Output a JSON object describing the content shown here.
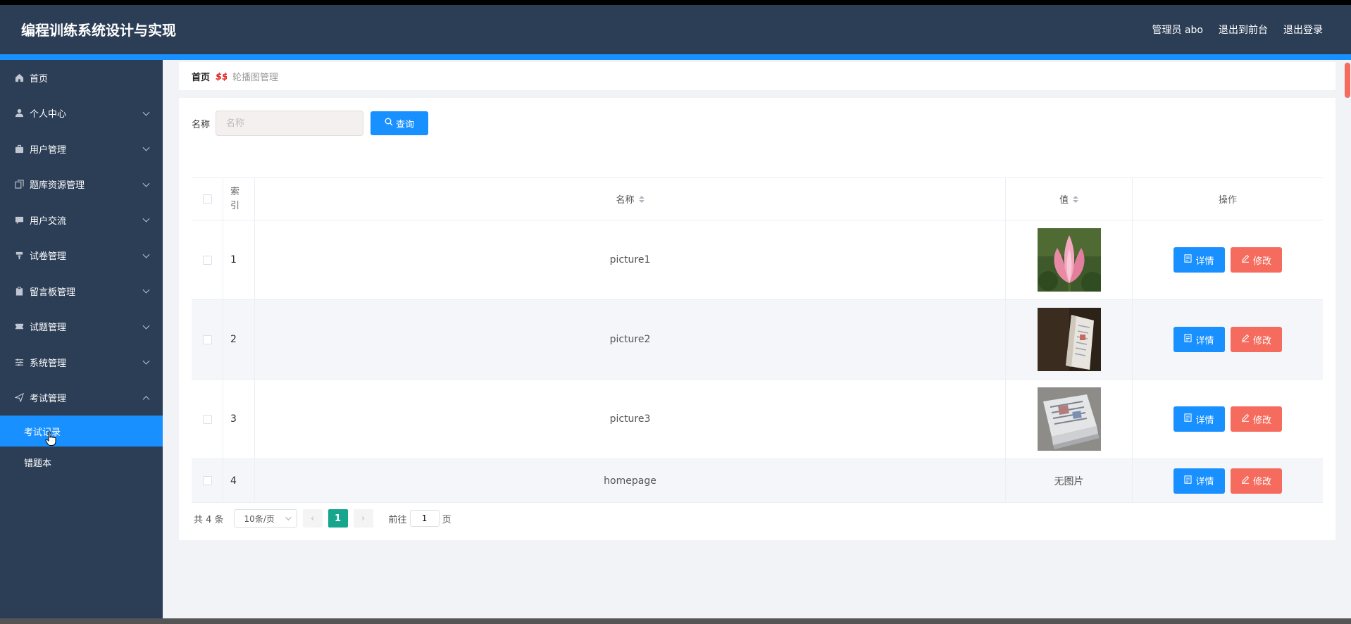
{
  "header": {
    "title": "编程训练系统设计与实现",
    "user_label": "管理员 abo",
    "to_frontend": "退出到前台",
    "logout": "退出登录"
  },
  "sidebar": {
    "items": [
      {
        "label": "首页",
        "icon": "home-icon"
      },
      {
        "label": "个人中心",
        "icon": "user-icon"
      },
      {
        "label": "用户管理",
        "icon": "briefcase-icon"
      },
      {
        "label": "题库资源管理",
        "icon": "copy-icon"
      },
      {
        "label": "用户交流",
        "icon": "chat-icon"
      },
      {
        "label": "试卷管理",
        "icon": "cup-icon"
      },
      {
        "label": "留言板管理",
        "icon": "clipboard-icon"
      },
      {
        "label": "试题管理",
        "icon": "ticket-icon"
      },
      {
        "label": "系统管理",
        "icon": "sliders-icon"
      },
      {
        "label": "考试管理",
        "icon": "send-icon"
      }
    ],
    "subitems": [
      {
        "label": "考试记录",
        "active": true
      },
      {
        "label": "错题本",
        "active": false
      }
    ]
  },
  "breadcrumb": {
    "home": "首页",
    "current": "轮播图管理"
  },
  "search": {
    "label": "名称",
    "placeholder": "名称",
    "button": "查询"
  },
  "table": {
    "headers": {
      "index": "索引",
      "name": "名称",
      "value": "值",
      "actions": "操作"
    },
    "rows": [
      {
        "index": "1",
        "name": "picture1",
        "value_type": "image",
        "image": "lotus"
      },
      {
        "index": "2",
        "name": "picture2",
        "value_type": "image",
        "image": "book"
      },
      {
        "index": "3",
        "name": "picture3",
        "value_type": "image",
        "image": "newspaper"
      },
      {
        "index": "4",
        "name": "homepage",
        "value_type": "text",
        "value_text": "无图片"
      }
    ],
    "detail_label": "详情",
    "edit_label": "修改"
  },
  "pagination": {
    "total": "共 4 条",
    "page_size": "10条/页",
    "current_page": "1",
    "goto_label": "前往",
    "goto_value": "1",
    "page_unit": "页"
  },
  "colors": {
    "header_bg": "#2c3e56",
    "accent": "#1890ff",
    "danger": "#f56c5e",
    "page_active": "#16a58d"
  }
}
